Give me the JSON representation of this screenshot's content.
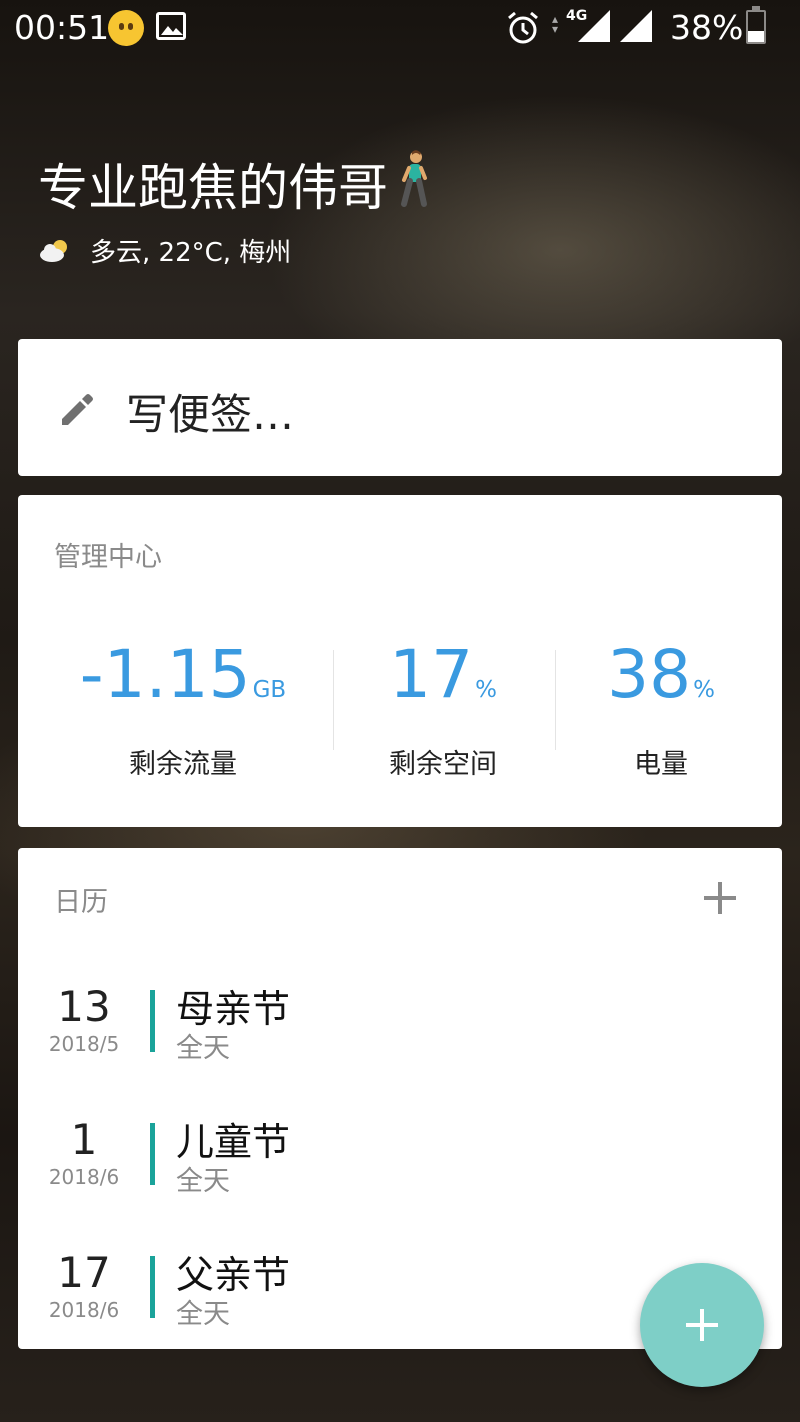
{
  "status_bar": {
    "time": "00:51",
    "network": "4G",
    "battery": "38%",
    "battery_level": 0.38,
    "icons": [
      "emoji-neutral-icon",
      "image-icon",
      "alarm-icon",
      "signal-icon",
      "signal-icon",
      "battery-icon"
    ]
  },
  "header": {
    "title": "专业跑焦的伟哥",
    "title_emoji": "person-walking-icon",
    "weather": "多云, 22°C, 梅州",
    "weather_icon": "partly-cloudy-icon"
  },
  "note": {
    "placeholder": "写便签…",
    "icon": "pencil-icon"
  },
  "management": {
    "title": "管理中心",
    "stats": [
      {
        "value": "-1.15",
        "unit": "GB",
        "label": "剩余流量"
      },
      {
        "value": "17",
        "unit": "%",
        "label": "剩余空间"
      },
      {
        "value": "38",
        "unit": "%",
        "label": "电量"
      }
    ]
  },
  "calendar": {
    "title": "日历",
    "add_icon": "plus-icon",
    "events": [
      {
        "day": "13",
        "date": "2018/5",
        "name": "母亲节",
        "sub": "全天"
      },
      {
        "day": "1",
        "date": "2018/6",
        "name": "儿童节",
        "sub": "全天"
      },
      {
        "day": "17",
        "date": "2018/6",
        "name": "父亲节",
        "sub": "全天"
      }
    ]
  },
  "colors": {
    "accent_blue": "#3a9ae0",
    "event_bar": "#1aa39a",
    "fab": "#7ecfc7"
  },
  "fab_icon": "plus-icon"
}
